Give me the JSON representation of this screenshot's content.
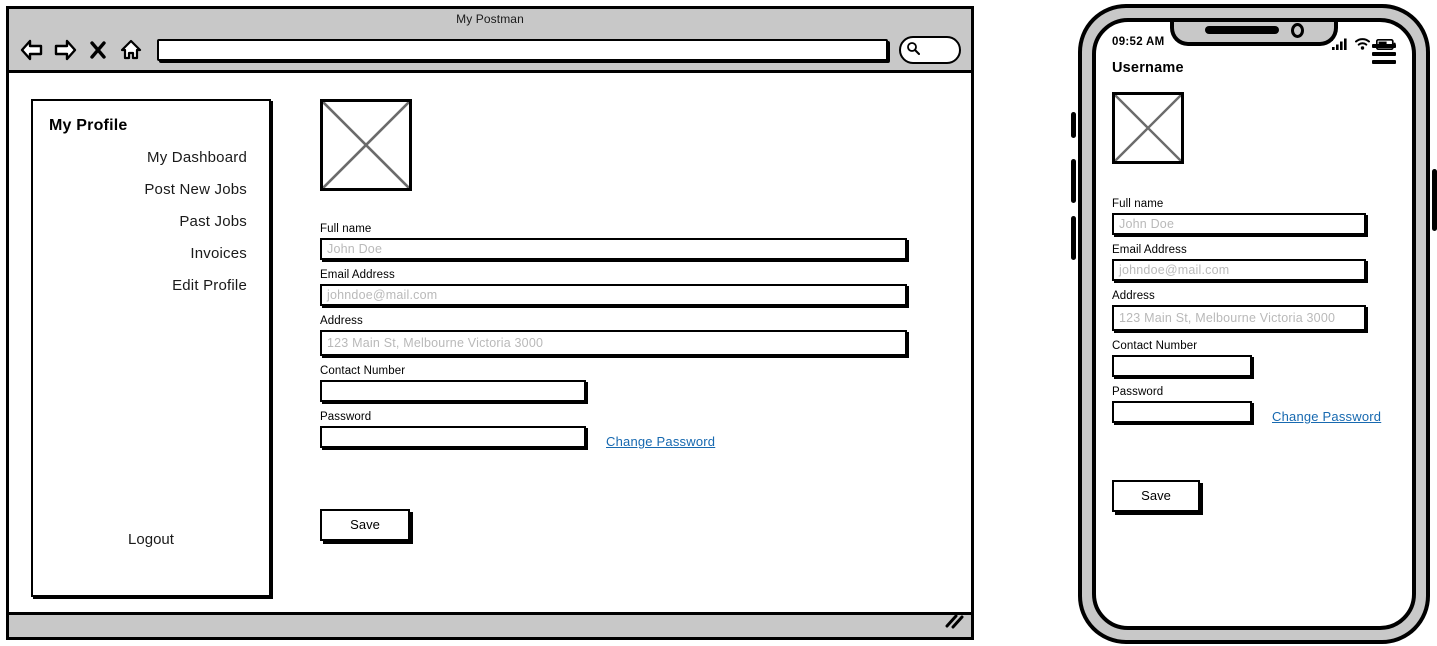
{
  "browser": {
    "title": "My Postman",
    "address_value": "",
    "address_placeholder": "",
    "nav_icons": [
      "back-arrow-icon",
      "forward-arrow-icon",
      "close-x-icon",
      "home-icon"
    ],
    "search_icon": "magnifier-icon",
    "resize_grip": "resize-grip-icon"
  },
  "sidebar": {
    "title": "My Profile",
    "items": [
      {
        "label": "My Dashboard"
      },
      {
        "label": "Post New Jobs"
      },
      {
        "label": "Past Jobs"
      },
      {
        "label": "Invoices"
      },
      {
        "label": "Edit Profile"
      }
    ],
    "logout_label": "Logout"
  },
  "form": {
    "avatar_icon": "image-placeholder-icon",
    "fields": [
      {
        "label": "Full name",
        "placeholder": "John Doe",
        "value": "",
        "width": "wide"
      },
      {
        "label": "Email Address",
        "placeholder": "johndoe@mail.com",
        "value": "",
        "width": "wide"
      },
      {
        "label": "Address",
        "placeholder": "123 Main St, Melbourne Victoria 3000",
        "value": "",
        "width": "wide"
      },
      {
        "label": "Contact Number",
        "placeholder": "",
        "value": "",
        "width": "narrow"
      },
      {
        "label": "Password",
        "placeholder": "",
        "value": "",
        "width": "narrow"
      }
    ],
    "change_password_label": "Change Password",
    "save_label": "Save",
    "link_color": "#1769b0"
  },
  "phone": {
    "status_time": "09:52 AM",
    "status_icons": [
      "signal-bars-icon",
      "wifi-icon",
      "battery-icon"
    ],
    "username": "Username",
    "menu_icon": "hamburger-menu-icon",
    "avatar_icon": "image-placeholder-icon",
    "fields": [
      {
        "label": "Full name",
        "placeholder": "John Doe",
        "value": "",
        "width": "wide"
      },
      {
        "label": "Email Address",
        "placeholder": "johndoe@mail.com",
        "value": "",
        "width": "wide"
      },
      {
        "label": "Address",
        "placeholder": "123 Main St, Melbourne Victoria 3000",
        "value": "",
        "width": "wide"
      },
      {
        "label": "Contact Number",
        "placeholder": "",
        "value": "",
        "width": "narrow"
      },
      {
        "label": "Password",
        "placeholder": "",
        "value": "",
        "width": "narrow"
      }
    ],
    "change_password_label": "Change Password",
    "save_label": "Save"
  }
}
